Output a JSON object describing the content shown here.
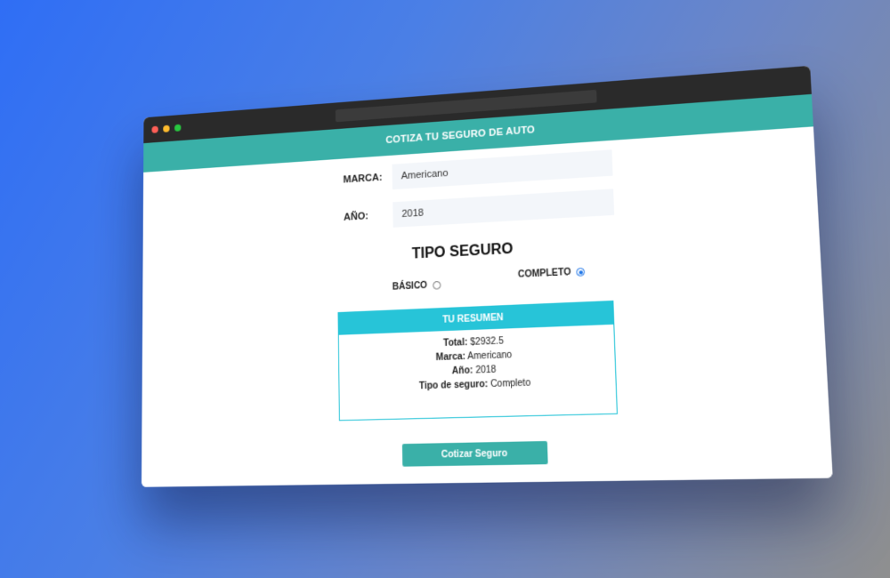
{
  "header": {
    "title": "COTIZA TU SEGURO DE AUTO"
  },
  "form": {
    "marca": {
      "label": "MARCA:",
      "value": "Americano"
    },
    "anio": {
      "label": "AÑO:",
      "value": "2018"
    },
    "tipo_title": "TIPO SEGURO",
    "options": [
      {
        "label": "BÁSICO",
        "checked": false
      },
      {
        "label": "COMPLETO",
        "checked": true
      }
    ]
  },
  "summary": {
    "title": "TU RESUMEN",
    "rows": [
      {
        "label": "Total:",
        "value": "$2932.5"
      },
      {
        "label": "Marca:",
        "value": "Americano"
      },
      {
        "label": "Año:",
        "value": "2018"
      },
      {
        "label": "Tipo de seguro:",
        "value": "Completo"
      }
    ]
  },
  "submit_label": "Cotizar Seguro",
  "colors": {
    "header": "#3ab0a8",
    "summary_accent": "#27c4d8",
    "button": "#3ab0a8",
    "background_start": "#2f6ef5",
    "background_end": "#8f8f8f"
  }
}
